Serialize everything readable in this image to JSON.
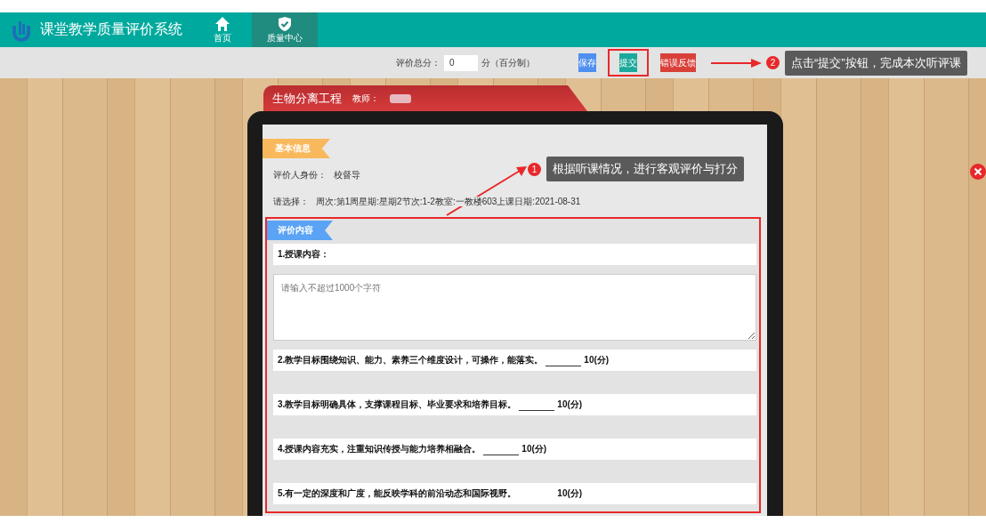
{
  "app": {
    "title": "课堂教学质量评价系统"
  },
  "nav": [
    {
      "label": "首页",
      "selected": false
    },
    {
      "label": "质量中心",
      "selected": true
    }
  ],
  "toolbar": {
    "score_label": "评价总分：",
    "score_value": "0",
    "score_unit": "分（百分制）",
    "buttons": [
      {
        "label": "保存",
        "kind": "save",
        "highlighted": false
      },
      {
        "label": "提交",
        "kind": "submit",
        "highlighted": true
      },
      {
        "label": "错误反馈",
        "kind": "feedback",
        "highlighted": false
      }
    ]
  },
  "course": {
    "title": "生物分离工程",
    "teacher_label": "教师："
  },
  "basic_info": {
    "heading": "基本信息",
    "evaluator_label": "评价人身份：",
    "evaluator_value": "校督导",
    "select_label": "请选择：",
    "select_value": "周次:第1周星期:星期2节次:1-2教室:一教楼603上课日期:2021-08-31"
  },
  "evaluation": {
    "heading": "评价内容",
    "highlighted": true,
    "items": [
      {
        "kind": "text",
        "label": "1.授课内容：",
        "placeholder": "请输入不超过1000个字符"
      },
      {
        "kind": "score",
        "label": "2.教学目标围绕知识、能力、素养三个维度设计，可操作，能落实。",
        "max": "10(分)",
        "underline": true
      },
      {
        "kind": "score",
        "label": "3.教学目标明确具体，支撑课程目标、毕业要求和培养目标。",
        "max": "10(分)",
        "underline": true
      },
      {
        "kind": "score",
        "label": "4.授课内容充实，注重知识传授与能力培养相融合。",
        "max": "10(分)",
        "underline": true
      },
      {
        "kind": "score",
        "label": "5.有一定的深度和广度，能反映学科的前沿动态和国际视野。",
        "max": "10(分)",
        "underline": false
      }
    ]
  },
  "callouts": [
    {
      "number": "1",
      "text": "根据听课情况，进行客观评价与打分"
    },
    {
      "number": "2",
      "text": "点击“提交”按钮，完成本次听评课"
    }
  ]
}
